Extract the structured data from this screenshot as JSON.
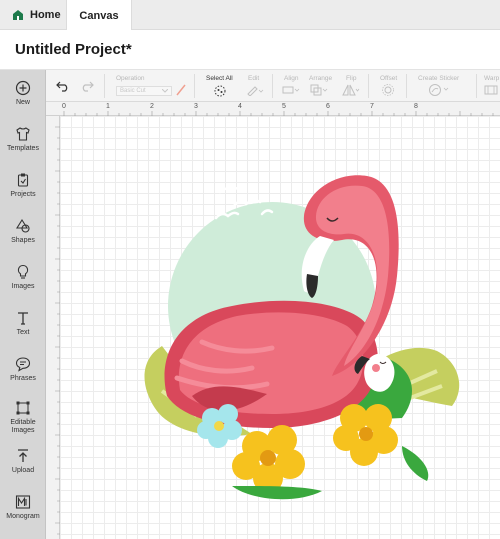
{
  "tabs": {
    "home": "Home",
    "canvas": "Canvas"
  },
  "project": {
    "title": "Untitled Project*"
  },
  "sidebar": {
    "items": [
      {
        "label": "New",
        "icon": "plus-circle-icon"
      },
      {
        "label": "Templates",
        "icon": "shirt-icon"
      },
      {
        "label": "Projects",
        "icon": "clipboard-icon"
      },
      {
        "label": "Shapes",
        "icon": "shapes-icon"
      },
      {
        "label": "Images",
        "icon": "lightbulb-icon"
      },
      {
        "label": "Text",
        "icon": "text-t-icon"
      },
      {
        "label": "Phrases",
        "icon": "speech-bubble-icon"
      },
      {
        "label": "Editable Images",
        "icon": "editable-image-icon"
      },
      {
        "label": "Upload",
        "icon": "upload-icon"
      },
      {
        "label": "Monogram",
        "icon": "monogram-icon"
      }
    ]
  },
  "toolbar": {
    "operation_label": "Operation",
    "operation_value": "Basic Cut",
    "select_all": "Select All",
    "edit": "Edit",
    "align": "Align",
    "arrange": "Arrange",
    "flip": "Flip",
    "offset": "Offset",
    "create_sticker": "Create Sticker",
    "warp": "Warp"
  },
  "ruler": {
    "marks": [
      "0",
      "1",
      "2",
      "3",
      "4",
      "5",
      "6",
      "7",
      "8"
    ]
  },
  "colors": {
    "flamingo": "#ee6f7e",
    "flamingo_dark": "#d9485b",
    "leaf": "#c5cf5f",
    "green": "#3aa83e",
    "flower_yellow": "#f6c21e",
    "flower_blue": "#a5e6ec",
    "background_circle": "#cfecd9"
  }
}
